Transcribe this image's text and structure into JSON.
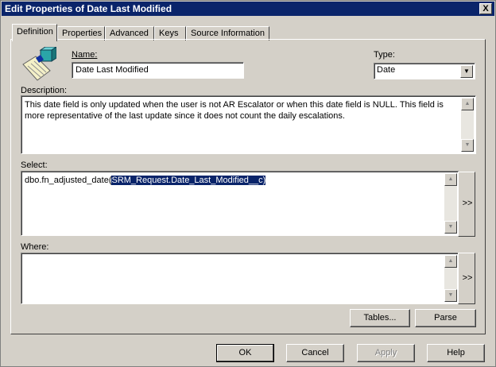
{
  "window": {
    "title": "Edit Properties of Date Last Modified",
    "close_label": "X"
  },
  "tabs": [
    {
      "label": "Definition",
      "active": true
    },
    {
      "label": "Properties"
    },
    {
      "label": "Advanced"
    },
    {
      "label": "Keys"
    },
    {
      "label": "Source Information"
    }
  ],
  "form": {
    "name_label": "Name:",
    "name_value": "Date Last Modified",
    "type_label": "Type:",
    "type_value": "Date",
    "description_label": "Description:",
    "description_value": "This date field is only updated when the user is not AR Escalator or when this date field is NULL.  This field is more representative of the last update since it does not count the daily escalations.",
    "select_label": "Select:",
    "select_prefix": "dbo.fn_adjusted_date(",
    "select_selected": "SRM_Request.Date_Last_Modified__c)",
    "where_label": "Where:",
    "where_value": "",
    "insert_label": ">>"
  },
  "buttons": {
    "tables": "Tables...",
    "parse": "Parse",
    "ok": "OK",
    "cancel": "Cancel",
    "apply": "Apply",
    "help": "Help"
  },
  "icons": {
    "field_icon": "field-definition-icon",
    "dropdown": "chevron-down-icon"
  }
}
